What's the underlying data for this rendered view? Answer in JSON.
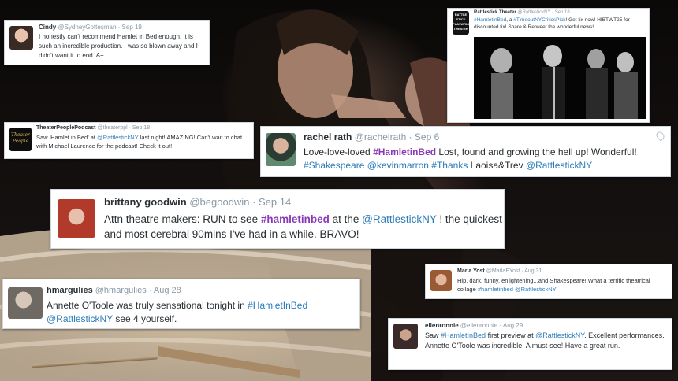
{
  "tweets": {
    "cindy": {
      "name": "Cindy",
      "handle": "@SydneyGottesman",
      "date": "· Sep 19",
      "text": "I honestly can't recommend Hamlet in Bed enough. It is such an incredible production. I was so blown away and I didn't want it to end. A+"
    },
    "rattlestick": {
      "name": "Rattlestick Theater",
      "handle": "@RattlestickNY",
      "date": "· Sep 18",
      "parts": [
        "#HamletInBed",
        ", a ",
        "#TimeoutNYCriticsPick",
        "! Get tix now! HIBTWT25 for discounted tix! Share & Retweet the wonderful news!"
      ],
      "logo_lines": [
        "RATTLE",
        "STICK",
        "PLAYWRIGHTS",
        "THEATER"
      ]
    },
    "theaterpeople": {
      "name": "TheaterPeoplePodcast",
      "handle": "@theaterppl",
      "date": "· Sep 18",
      "parts": [
        "Saw 'Hamlet in Bed' at ",
        "@RattlestickNY",
        " last night! AMAZING! Can't wait to chat with Michael Laurence for the podcast! Check it out!"
      ],
      "logo_lines": [
        "Theater",
        "People"
      ]
    },
    "rachel": {
      "name": "rachel rath",
      "handle": "@rachelrath",
      "date": "· Sep 6",
      "parts": [
        "Love-love-loved ",
        "#HamletinBed",
        " Lost, found and growing the hell up! Wonderful! ",
        "#Shakespeare",
        " ",
        "@kevinmarron",
        " ",
        "#Thanks",
        " Laoisa&Trev ",
        "@RattlestickNY"
      ]
    },
    "brittany": {
      "name": "brittany goodwin",
      "handle": "@begoodwin",
      "date": "· Sep 14",
      "parts": [
        "Attn theatre makers: RUN to see ",
        "#hamletinbed",
        " at the ",
        "@RattlestickNY",
        " ! the quickest and most cerebral 90mins I've had in a while. BRAVO!"
      ]
    },
    "marla": {
      "name": "Marla Yost",
      "handle": "@MarlaEYost",
      "date": "· Aug 31",
      "parts": [
        "Hip, dark, funny, enlightening...and Shakespeare! What a terrific theatrical collage ",
        "#hamletinbed",
        " ",
        "@RattlestickNY"
      ]
    },
    "hmargulies": {
      "name": "hmargulies",
      "handle": "@hmargulies",
      "date": "· Aug 28",
      "parts": [
        "Annette O'Toole was truly sensational tonight in ",
        "#HamletInBed",
        " ",
        "@RattlestickNY",
        " see 4 yourself."
      ]
    },
    "ellenronnie": {
      "name": "ellenronnie",
      "handle": "@ellenronnie",
      "date": "· Aug 29",
      "parts": [
        "Saw ",
        "#HamletInBed",
        " first preview at ",
        "@RattlestickNY",
        ".  Excellent performances. Annette O'Toole was incredible! A must-see! Have a great run."
      ]
    }
  },
  "colors": {
    "link": "#2b7bb9",
    "hashtag_highlight": "#8a3ab9",
    "name_text": "#292f33",
    "meta_text": "#8899a6"
  },
  "icons": {
    "location": "location-pin-icon"
  }
}
